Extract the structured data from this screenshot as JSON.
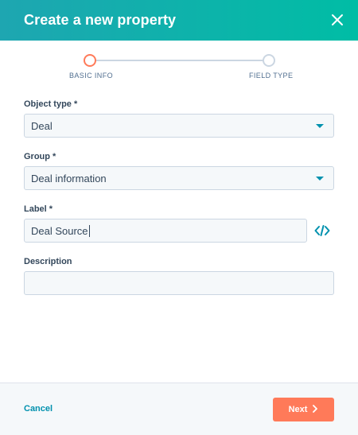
{
  "header": {
    "title": "Create a new property",
    "close_icon": "close-icon"
  },
  "stepper": {
    "steps": [
      {
        "label": "BASIC INFO",
        "state": "active"
      },
      {
        "label": "FIELD TYPE",
        "state": "inactive"
      }
    ]
  },
  "form": {
    "object_type": {
      "label": "Object type *",
      "value": "Deal"
    },
    "group": {
      "label": "Group *",
      "value": "Deal information"
    },
    "label": {
      "label": "Label *",
      "value": "Deal Source",
      "code_icon": "code-icon"
    },
    "description": {
      "label": "Description",
      "value": ""
    }
  },
  "footer": {
    "cancel_label": "Cancel",
    "next_label": "Next"
  },
  "colors": {
    "header_start": "#1ea6b1",
    "header_end": "#00bda5",
    "accent": "#ff7a59",
    "link": "#0091ae"
  }
}
